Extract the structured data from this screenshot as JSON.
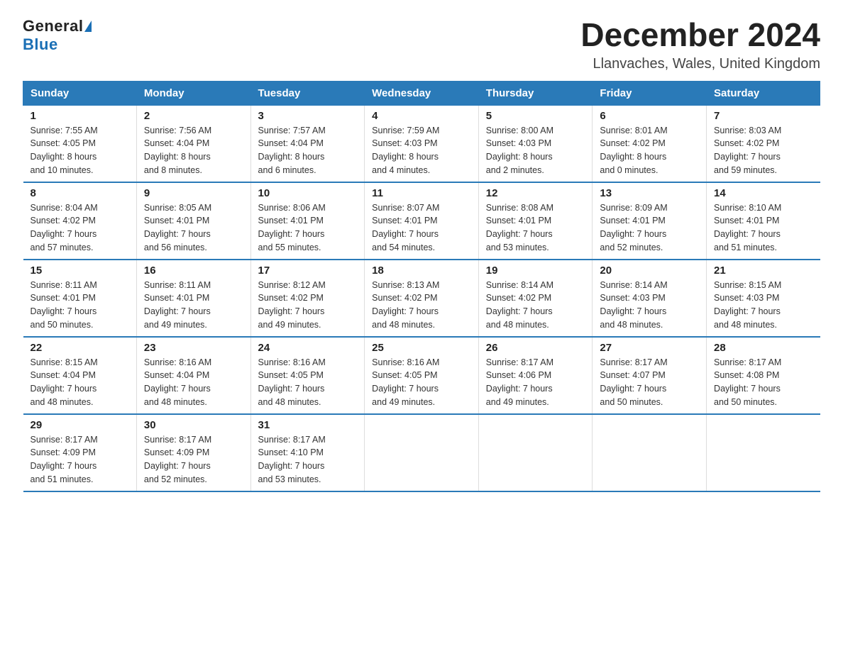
{
  "header": {
    "logo_general": "General",
    "logo_blue": "Blue",
    "title": "December 2024",
    "subtitle": "Llanvaches, Wales, United Kingdom"
  },
  "weekdays": [
    "Sunday",
    "Monday",
    "Tuesday",
    "Wednesday",
    "Thursday",
    "Friday",
    "Saturday"
  ],
  "weeks": [
    [
      {
        "day": "1",
        "info": "Sunrise: 7:55 AM\nSunset: 4:05 PM\nDaylight: 8 hours\nand 10 minutes."
      },
      {
        "day": "2",
        "info": "Sunrise: 7:56 AM\nSunset: 4:04 PM\nDaylight: 8 hours\nand 8 minutes."
      },
      {
        "day": "3",
        "info": "Sunrise: 7:57 AM\nSunset: 4:04 PM\nDaylight: 8 hours\nand 6 minutes."
      },
      {
        "day": "4",
        "info": "Sunrise: 7:59 AM\nSunset: 4:03 PM\nDaylight: 8 hours\nand 4 minutes."
      },
      {
        "day": "5",
        "info": "Sunrise: 8:00 AM\nSunset: 4:03 PM\nDaylight: 8 hours\nand 2 minutes."
      },
      {
        "day": "6",
        "info": "Sunrise: 8:01 AM\nSunset: 4:02 PM\nDaylight: 8 hours\nand 0 minutes."
      },
      {
        "day": "7",
        "info": "Sunrise: 8:03 AM\nSunset: 4:02 PM\nDaylight: 7 hours\nand 59 minutes."
      }
    ],
    [
      {
        "day": "8",
        "info": "Sunrise: 8:04 AM\nSunset: 4:02 PM\nDaylight: 7 hours\nand 57 minutes."
      },
      {
        "day": "9",
        "info": "Sunrise: 8:05 AM\nSunset: 4:01 PM\nDaylight: 7 hours\nand 56 minutes."
      },
      {
        "day": "10",
        "info": "Sunrise: 8:06 AM\nSunset: 4:01 PM\nDaylight: 7 hours\nand 55 minutes."
      },
      {
        "day": "11",
        "info": "Sunrise: 8:07 AM\nSunset: 4:01 PM\nDaylight: 7 hours\nand 54 minutes."
      },
      {
        "day": "12",
        "info": "Sunrise: 8:08 AM\nSunset: 4:01 PM\nDaylight: 7 hours\nand 53 minutes."
      },
      {
        "day": "13",
        "info": "Sunrise: 8:09 AM\nSunset: 4:01 PM\nDaylight: 7 hours\nand 52 minutes."
      },
      {
        "day": "14",
        "info": "Sunrise: 8:10 AM\nSunset: 4:01 PM\nDaylight: 7 hours\nand 51 minutes."
      }
    ],
    [
      {
        "day": "15",
        "info": "Sunrise: 8:11 AM\nSunset: 4:01 PM\nDaylight: 7 hours\nand 50 minutes."
      },
      {
        "day": "16",
        "info": "Sunrise: 8:11 AM\nSunset: 4:01 PM\nDaylight: 7 hours\nand 49 minutes."
      },
      {
        "day": "17",
        "info": "Sunrise: 8:12 AM\nSunset: 4:02 PM\nDaylight: 7 hours\nand 49 minutes."
      },
      {
        "day": "18",
        "info": "Sunrise: 8:13 AM\nSunset: 4:02 PM\nDaylight: 7 hours\nand 48 minutes."
      },
      {
        "day": "19",
        "info": "Sunrise: 8:14 AM\nSunset: 4:02 PM\nDaylight: 7 hours\nand 48 minutes."
      },
      {
        "day": "20",
        "info": "Sunrise: 8:14 AM\nSunset: 4:03 PM\nDaylight: 7 hours\nand 48 minutes."
      },
      {
        "day": "21",
        "info": "Sunrise: 8:15 AM\nSunset: 4:03 PM\nDaylight: 7 hours\nand 48 minutes."
      }
    ],
    [
      {
        "day": "22",
        "info": "Sunrise: 8:15 AM\nSunset: 4:04 PM\nDaylight: 7 hours\nand 48 minutes."
      },
      {
        "day": "23",
        "info": "Sunrise: 8:16 AM\nSunset: 4:04 PM\nDaylight: 7 hours\nand 48 minutes."
      },
      {
        "day": "24",
        "info": "Sunrise: 8:16 AM\nSunset: 4:05 PM\nDaylight: 7 hours\nand 48 minutes."
      },
      {
        "day": "25",
        "info": "Sunrise: 8:16 AM\nSunset: 4:05 PM\nDaylight: 7 hours\nand 49 minutes."
      },
      {
        "day": "26",
        "info": "Sunrise: 8:17 AM\nSunset: 4:06 PM\nDaylight: 7 hours\nand 49 minutes."
      },
      {
        "day": "27",
        "info": "Sunrise: 8:17 AM\nSunset: 4:07 PM\nDaylight: 7 hours\nand 50 minutes."
      },
      {
        "day": "28",
        "info": "Sunrise: 8:17 AM\nSunset: 4:08 PM\nDaylight: 7 hours\nand 50 minutes."
      }
    ],
    [
      {
        "day": "29",
        "info": "Sunrise: 8:17 AM\nSunset: 4:09 PM\nDaylight: 7 hours\nand 51 minutes."
      },
      {
        "day": "30",
        "info": "Sunrise: 8:17 AM\nSunset: 4:09 PM\nDaylight: 7 hours\nand 52 minutes."
      },
      {
        "day": "31",
        "info": "Sunrise: 8:17 AM\nSunset: 4:10 PM\nDaylight: 7 hours\nand 53 minutes."
      },
      null,
      null,
      null,
      null
    ]
  ]
}
